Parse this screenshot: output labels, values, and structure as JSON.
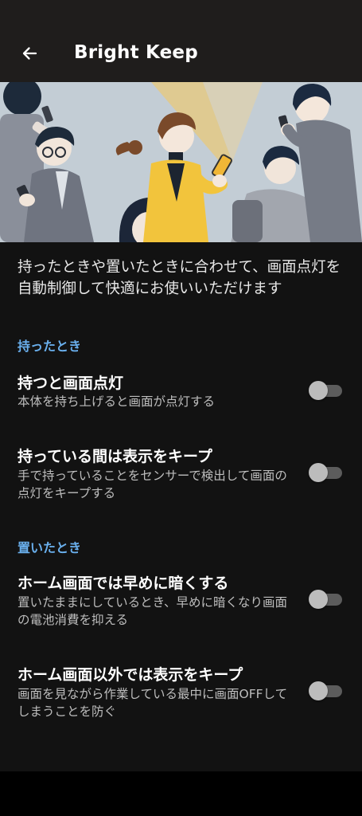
{
  "appbar": {
    "title": "Bright Keep",
    "back_icon": "arrow-left-icon"
  },
  "intro": "持ったときや置いたときに合わせて、画面点灯を自動制御して快適にお使いいただけます",
  "sections": [
    {
      "header": "持ったとき",
      "items": [
        {
          "title": "持つと画面点灯",
          "subtitle": "本体を持ち上げると画面が点灯する",
          "enabled": false
        },
        {
          "title": "持っている間は表示をキープ",
          "subtitle": "手で持っていることをセンサーで検出して画面の点灯をキープする",
          "enabled": false
        }
      ]
    },
    {
      "header": "置いたとき",
      "items": [
        {
          "title": "ホーム画面では早めに暗くする",
          "subtitle": "置いたままにしているとき、早めに暗くなり画面の電池消費を抑える",
          "enabled": false
        },
        {
          "title": "ホーム画面以外では表示をキープ",
          "subtitle": "画面を見ながら作業している最中に画面OFFしてしまうことを防ぐ",
          "enabled": false
        }
      ]
    }
  ],
  "colors": {
    "accent": "#6ab0ee",
    "background": "#121212",
    "appbar": "#1f1d1c",
    "switch_off_thumb": "#bcbcbc",
    "switch_off_track": "#5c5c5c",
    "illustration_highlight": "#f5c23b"
  }
}
